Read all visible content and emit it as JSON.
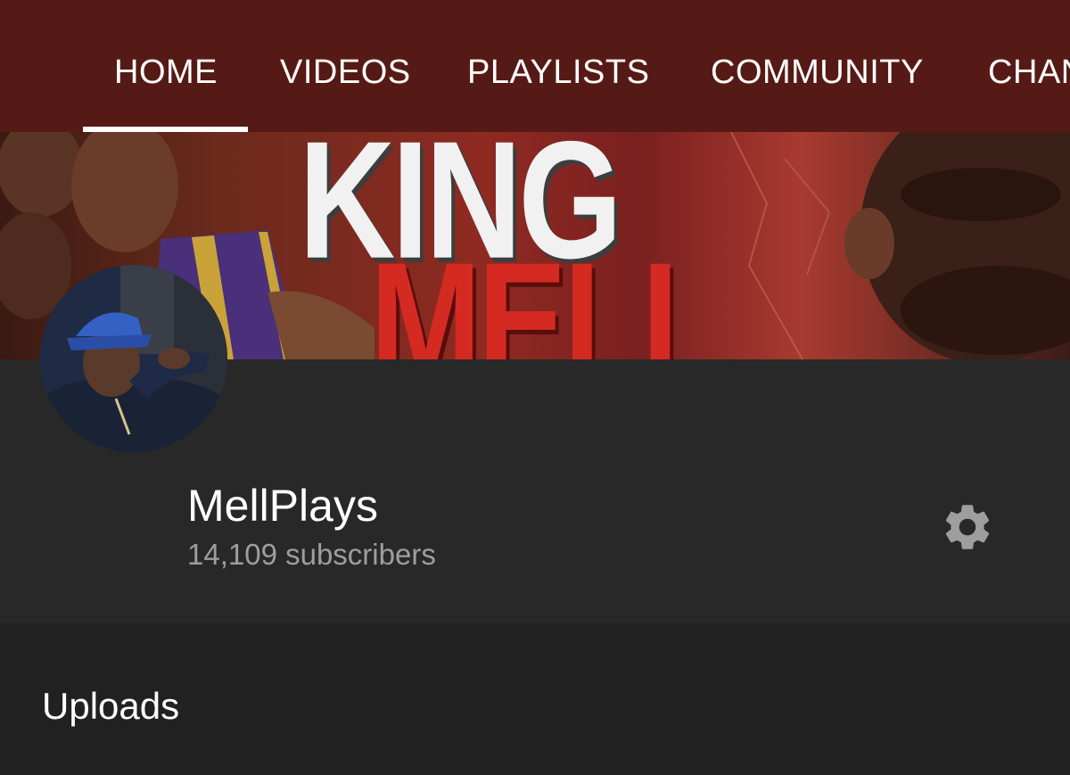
{
  "tabs": [
    {
      "label": "HOME",
      "selected": true
    },
    {
      "label": "VIDEOS"
    },
    {
      "label": "PLAYLISTS"
    },
    {
      "label": "COMMUNITY"
    },
    {
      "label": "CHAN"
    }
  ],
  "banner": {
    "line1": "KING",
    "line2": "MELL"
  },
  "channel": {
    "name": "MellPlays",
    "subscribers": "14,109 subscribers",
    "settings_icon": "gear-icon"
  },
  "section": {
    "title": "Uploads"
  },
  "colors": {
    "tab_bar": "#561a16",
    "header_bg": "#282828",
    "page_bg": "#212121",
    "subscriber_text": "#9e9e9e",
    "gear": "#9e9e9e"
  }
}
